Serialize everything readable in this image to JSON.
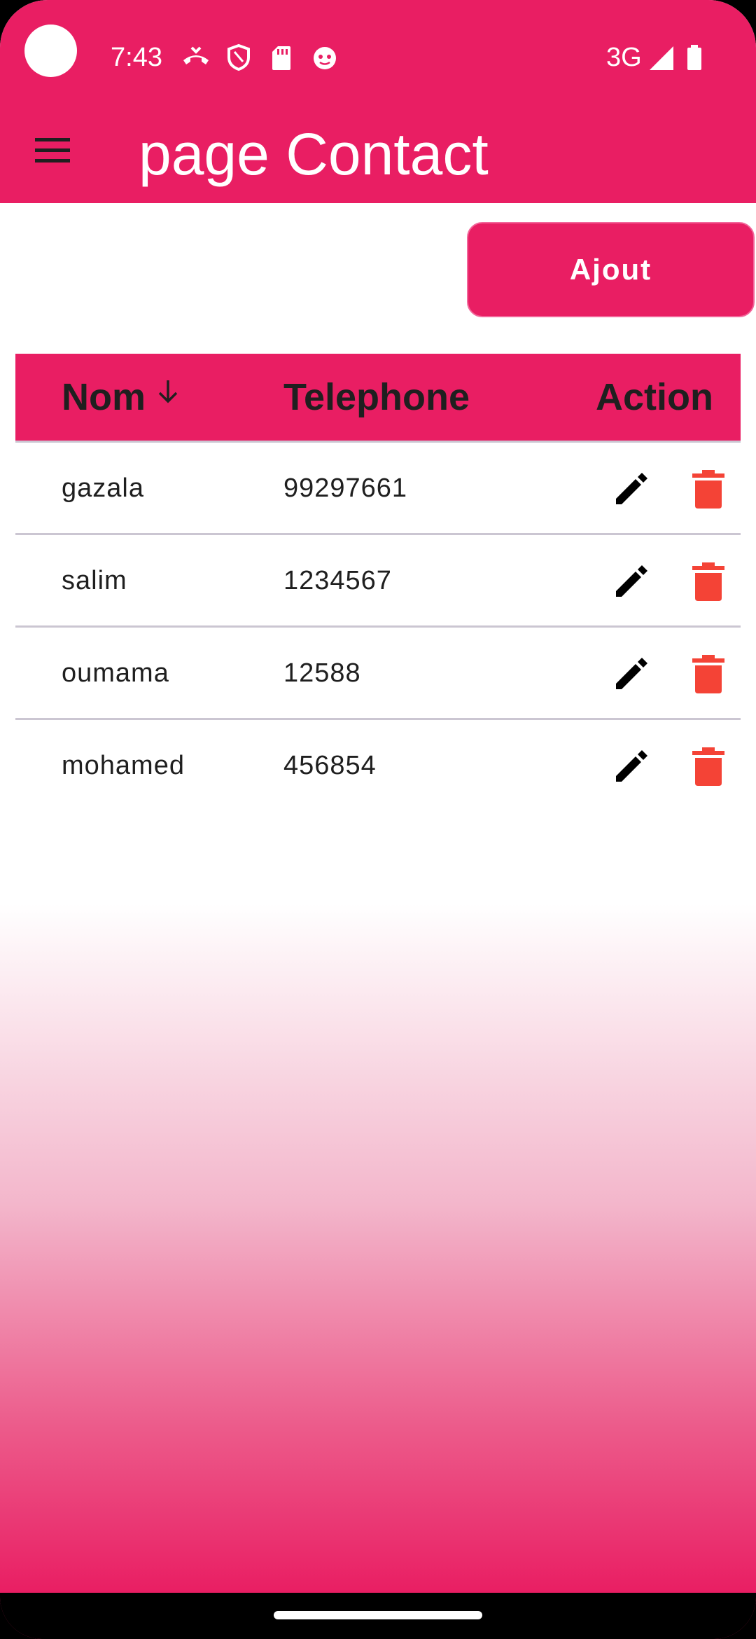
{
  "status": {
    "time": "7:43",
    "network": "3G"
  },
  "appbar": {
    "title": "page Contact"
  },
  "actions": {
    "add_label": "Ajout"
  },
  "table": {
    "headers": {
      "name": "Nom",
      "phone": "Telephone",
      "action": "Action"
    },
    "rows": [
      {
        "name": "gazala",
        "phone": "99297661"
      },
      {
        "name": "salim",
        "phone": "1234567"
      },
      {
        "name": "oumama",
        "phone": "12588"
      },
      {
        "name": "mohamed",
        "phone": "456854"
      }
    ]
  },
  "colors": {
    "accent": "#e91e63",
    "delete": "#f44336"
  }
}
